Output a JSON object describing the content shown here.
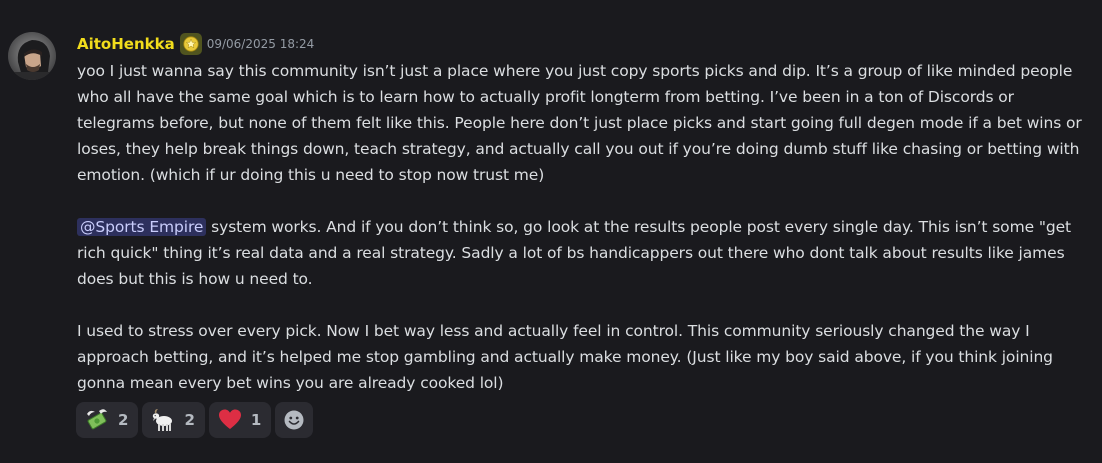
{
  "message": {
    "author": "AitoHenkka",
    "author_color": "#f2dd1c",
    "timestamp": "09/06/2025 18:24",
    "role_icon": "star-badge-icon",
    "paragraphs": {
      "p1": "yoo I just wanna say this community isn’t just a place where you just copy sports picks and dip. It’s a group of like minded people who all have the same goal which is to learn how to actually profit longterm from betting. I’ve been in a ton of Discords or telegrams before, but none of them felt like this. People here don’t just place picks and start going full degen mode if a bet wins or loses, they help break things down, teach strategy, and actually call you out if you’re doing dumb stuff like chasing or betting with emotion. (which if ur doing this u need to stop now trust me)",
      "p2_mention": "@Sports Empire",
      "p2_rest": " system works. And if you don’t think so, go look at the results people post every single day. This isn’t some \"get rich quick\" thing it’s real data and a real strategy. Sadly a lot of bs handicappers out there who dont talk about results like james does but this is how u need to.",
      "p3": "I used to stress over every pick. Now I bet way less and actually feel in control. This community seriously changed the way I approach betting, and it’s helped me stop gambling and actually make money. (Just like my boy said above, if you think joining gonna mean every bet wins you are already cooked lol)"
    }
  },
  "reactions": [
    {
      "icon": "money-with-wings-icon",
      "count": "2"
    },
    {
      "icon": "goat-icon",
      "count": "2"
    },
    {
      "icon": "red-heart-icon",
      "count": "1"
    }
  ],
  "add_reaction_icon": "smiley-face-icon",
  "colors": {
    "background": "#1a1a1e",
    "text": "#dbdee1",
    "timestamp": "#949ba4",
    "mention_bg": "#3b3f78",
    "reaction_bg": "#2b2b31"
  }
}
